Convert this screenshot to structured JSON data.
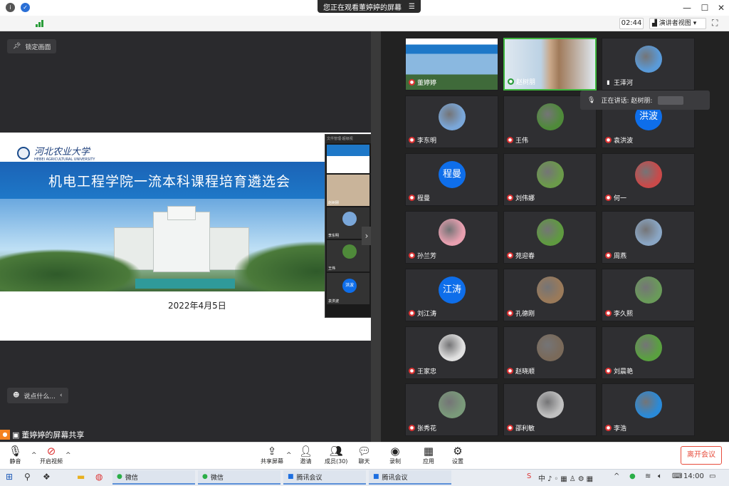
{
  "window": {
    "share_banner": "您正在观看董婷婷的屏幕",
    "min": "—",
    "max": "☐",
    "close": "✕"
  },
  "toolbar": {
    "timer": "02:44",
    "presenter_view": "演讲者视图"
  },
  "stage": {
    "pin_label": "锁定画面",
    "chat_placeholder": "说点什么...",
    "sharer_label": "董婷婷的屏幕共享"
  },
  "slide": {
    "university": "河北农业大学",
    "university_sub": "HEBEI AGRICULTURAL UNIVERSITY",
    "title": "机电工程学院一流本科课程培育遴选会",
    "date": "2022年4月5日"
  },
  "speaking": {
    "label": "正在讲话: 赵树朋:"
  },
  "participants": [
    {
      "name": "董婷婷",
      "mic": "muted",
      "avatar": "slide"
    },
    {
      "name": "赵树朋",
      "mic": "on",
      "avatar": "video"
    },
    {
      "name": "王泽河",
      "mic": "white",
      "avatar": "photo",
      "color": "#5a9ad8"
    },
    {
      "name": "李东明",
      "mic": "muted",
      "avatar": "photo",
      "color": "#7aa7d9"
    },
    {
      "name": "王伟",
      "mic": "muted",
      "avatar": "photo",
      "color": "#4f8a3a"
    },
    {
      "name": "袁洪波",
      "mic": "muted",
      "avatar": "text",
      "text": "洪波"
    },
    {
      "name": "程曼",
      "mic": "muted",
      "avatar": "text",
      "text": "程曼"
    },
    {
      "name": "刘伟娜",
      "mic": "muted",
      "avatar": "photo",
      "color": "#6b9a4a"
    },
    {
      "name": "何一",
      "mic": "muted",
      "avatar": "photo",
      "color": "#c94a4a"
    },
    {
      "name": "孙兰芳",
      "mic": "muted",
      "avatar": "photo",
      "color": "#e8a0b0"
    },
    {
      "name": "苑迎春",
      "mic": "muted",
      "avatar": "photo",
      "color": "#5f9a40"
    },
    {
      "name": "周燕",
      "mic": "muted",
      "avatar": "photo",
      "color": "#8aa6c4"
    },
    {
      "name": "刘江涛",
      "mic": "muted",
      "avatar": "text",
      "text": "江涛"
    },
    {
      "name": "孔德刚",
      "mic": "muted",
      "avatar": "photo",
      "color": "#9a7a5a"
    },
    {
      "name": "李久熙",
      "mic": "muted",
      "avatar": "photo",
      "color": "#6a9a5a"
    },
    {
      "name": "王家忠",
      "mic": "muted",
      "avatar": "photo",
      "color": "#e0e0e0"
    },
    {
      "name": "赵晓顺",
      "mic": "muted",
      "avatar": "photo",
      "color": "#7a6a5a"
    },
    {
      "name": "刘晨艳",
      "mic": "muted",
      "avatar": "photo",
      "color": "#5aa040"
    },
    {
      "name": "张秀花",
      "mic": "muted",
      "avatar": "photo",
      "color": "#7a9a7a"
    },
    {
      "name": "邵利敏",
      "mic": "muted",
      "avatar": "photo",
      "color": "#c0c0c0"
    },
    {
      "name": "李浩",
      "mic": "muted",
      "avatar": "photo",
      "color": "#2a8ad8"
    }
  ],
  "mini_strip": {
    "title": "文件管理·超级视",
    "labels": [
      "董婷婷",
      "赵树朋",
      "李东明",
      "王伟",
      "袁洪波"
    ],
    "badge": "洪波"
  },
  "controls": {
    "mute": "静音",
    "video": "开启视频",
    "share": "共享屏幕",
    "invite": "邀请",
    "members": "成员(30)",
    "chat": "聊天",
    "record": "录制",
    "apps": "应用",
    "settings": "设置",
    "leave": "离开会议"
  },
  "taskbar": {
    "apps": [
      "微信",
      "微信",
      "腾讯会议",
      "腾讯会议"
    ],
    "time": "14:00"
  }
}
